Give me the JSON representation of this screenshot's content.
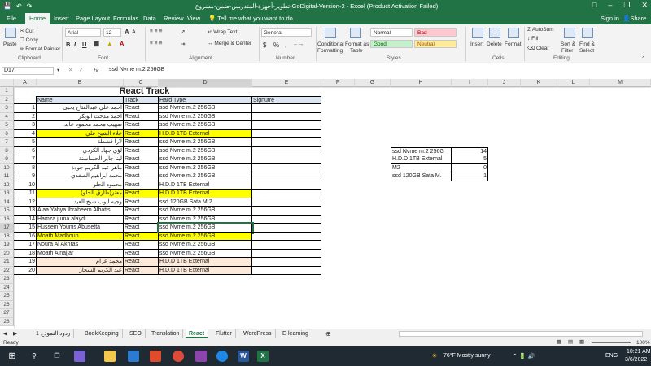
{
  "window": {
    "title": "تطوير-أجهزة-المتدربس-ضمن-مشروع-GoDigital-Version-2 - Excel (Product Activation Failed)",
    "autosave_icon": "save-icon",
    "undo_icon": "undo-icon",
    "redo_icon": "redo-icon"
  },
  "ribbon_tabs": [
    "File",
    "Home",
    "Insert",
    "Page Layout",
    "Formulas",
    "Data",
    "Review",
    "View"
  ],
  "tell_me": "Tell me what you want to do...",
  "sign_in": "Sign in",
  "share": "Share",
  "ribbon": {
    "clipboard": {
      "paste": "Paste",
      "cut": "Cut",
      "copy": "Copy",
      "format_painter": "Format Painter",
      "label": "Clipboard"
    },
    "font": {
      "name": "Arial",
      "size": "12",
      "grow": "A",
      "shrink": "A",
      "bold": "B",
      "italic": "I",
      "underline": "U",
      "label": "Font"
    },
    "alignment": {
      "wrap": "Wrap Text",
      "merge": "Merge & Center",
      "label": "Alignment"
    },
    "number": {
      "format": "General",
      "currency": "$",
      "percent": "%",
      "comma": ",",
      "label": "Number"
    },
    "styles": {
      "conditional": "Conditional",
      "conditional2": "Formatting",
      "format_as": "Format as",
      "table": "Table",
      "normal": "Normal",
      "bad": "Bad",
      "good": "Good",
      "neutral": "Neutral",
      "label": "Styles"
    },
    "cells": {
      "insert": "Insert",
      "delete": "Delete",
      "format": "Format",
      "label": "Cells"
    },
    "editing": {
      "autosum": "AutoSum",
      "fill": "Fill",
      "clear": "Clear",
      "sort": "Sort &",
      "filter": "Filter",
      "find": "Find &",
      "select": "Select",
      "label": "Editing"
    }
  },
  "formula_bar": {
    "name_box": "D17",
    "fx": "fx",
    "content": "ssd Nvme m.2 256GB"
  },
  "columns": [
    "A",
    "B",
    "C",
    "D",
    "E",
    "F",
    "G",
    "H",
    "I",
    "J",
    "K",
    "L",
    "M"
  ],
  "rows": [
    "1",
    "2",
    "3",
    "4",
    "5",
    "6",
    "7",
    "8",
    "9",
    "10",
    "11",
    "12",
    "13",
    "14",
    "15",
    "16",
    "17",
    "18",
    "19",
    "20",
    "21",
    "22",
    "23",
    "24",
    "25",
    "26",
    "27",
    "28"
  ],
  "sheet": {
    "title": "React Track",
    "headers": [
      "Name",
      "Track",
      "Hard Type",
      "Signutre"
    ],
    "records": [
      {
        "no": "1",
        "name": "احمد علي عبدالفتاح يحيى",
        "track": "React",
        "hard": "ssd Nvme m.2 256GB",
        "style": ""
      },
      {
        "no": "2",
        "name": "احمد مدحت ابوبكر",
        "track": "React",
        "hard": "ssd Nvme m.2 256GB",
        "style": ""
      },
      {
        "no": "3",
        "name": "صهيب محمد محمود عابد",
        "track": "React",
        "hard": "ssd Nvme m.2 256GB",
        "style": ""
      },
      {
        "no": "4",
        "name": "علاء الشيخ علي",
        "track": "React",
        "hard": "H.D.D 1TB External",
        "style": "y"
      },
      {
        "no": "5",
        "name": "لارا قشطة",
        "track": "React",
        "hard": "ssd Nvme m.2 256GB",
        "style": ""
      },
      {
        "no": "6",
        "name": "لؤي جهاد الكردي",
        "track": "React",
        "hard": "ssd Nvme m.2 256GB",
        "style": ""
      },
      {
        "no": "7",
        "name": "لينا جابر الحساسنة",
        "track": "React",
        "hard": "ssd Nvme m.2 256GB",
        "style": ""
      },
      {
        "no": "8",
        "name": "ماهر عبد الكريم جودة",
        "track": "React",
        "hard": "ssd Nvme m.2 256GB",
        "style": ""
      },
      {
        "no": "9",
        "name": "محمد ابراهيم الصفدي",
        "track": "React",
        "hard": "ssd Nvme m.2 256GB",
        "style": ""
      },
      {
        "no": "10",
        "name": "محمود الحلو",
        "track": "React",
        "hard": "H.D.D 1TB External",
        "style": ""
      },
      {
        "no": "11",
        "name": "معتز(طارق الحلو)",
        "track": "React",
        "hard": "H.D.D 1TB External",
        "style": "y"
      },
      {
        "no": "12",
        "name": "وجيه ايوب شيخ العيد",
        "track": "React",
        "hard": "ssd 120GB Sata M.2",
        "style": ""
      },
      {
        "no": "13",
        "name": "Alaa Yahya Ibraheem Albatts",
        "track": "React",
        "hard": "ssd Nvme m.2 256GB",
        "style": ""
      },
      {
        "no": "14",
        "name": "Hamza juma alaydi",
        "track": "React",
        "hard": "ssd Nvme m.2 256GB",
        "style": ""
      },
      {
        "no": "15",
        "name": "Hussein Younis Abusetta",
        "track": "React",
        "hard": "ssd Nvme m.2 256GB",
        "style": ""
      },
      {
        "no": "16",
        "name": "Moath Madhoun",
        "track": "React",
        "hard": "ssd Nvme m.2 256GB",
        "style": "y"
      },
      {
        "no": "17",
        "name": "Noura Al Akhras",
        "track": "React",
        "hard": "ssd Nvme m.2 256GB",
        "style": ""
      },
      {
        "no": "18",
        "name": "Moath Alnajjar",
        "track": "React",
        "hard": "ssd Nvme m.2 256GB",
        "style": ""
      },
      {
        "no": "19",
        "name": "محمد عزام",
        "track": "React",
        "hard": "H.D.D 1TB External",
        "style": "p"
      },
      {
        "no": "20",
        "name": "عبد الكريم السحار",
        "track": "React",
        "hard": "H.D.D 1TB External",
        "style": "p"
      }
    ],
    "summary": [
      {
        "label": "ssd Nvme m.2 256G",
        "count": "14"
      },
      {
        "label": "H.D.D 1TB External",
        "count": "5"
      },
      {
        "label": "M2",
        "count": "0"
      },
      {
        "label": "ssd 120GB Sata M.",
        "count": "1"
      }
    ]
  },
  "sheet_tabs": [
    "ردود النموذج 1",
    "BookKeeping",
    "SEO",
    "Translation",
    "React",
    "Flutter",
    "WordPress",
    "E-learning"
  ],
  "active_sheet": "React",
  "status": {
    "ready": "Ready",
    "zoom": "100%"
  },
  "taskbar": {
    "weather": "76°F  Mostly sunny",
    "lang": "ENG",
    "time": "10:21 AM",
    "date": "3/6/2022"
  },
  "colors": {
    "excel_green": "#217346",
    "highlight_yellow": "#ffff00",
    "highlight_peach": "#fde9d9",
    "header_blue": "#dce6f1"
  }
}
